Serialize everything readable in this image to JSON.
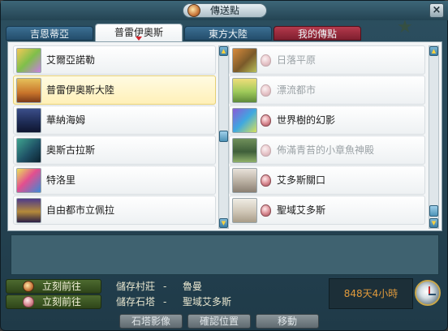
{
  "window": {
    "title": "傳送點"
  },
  "tabs": [
    {
      "label": "吉恩蒂亞",
      "active": false,
      "color": "#2e5e80"
    },
    {
      "label": "普雷伊奧斯",
      "active": true,
      "color": "#ffffff"
    },
    {
      "label": "東方大陸",
      "active": false,
      "color": "#2e5e80"
    },
    {
      "label": "我的傳點",
      "active": false,
      "color": "#9a2a3c"
    }
  ],
  "left_list": [
    {
      "label": "艾爾亞諾勒",
      "selected": false,
      "icon": "town-thumbnail"
    },
    {
      "label": "普雷伊奧斯大陸",
      "selected": true,
      "icon": "continent-thumbnail"
    },
    {
      "label": "華納海姆",
      "selected": false,
      "icon": "town-thumbnail"
    },
    {
      "label": "奧斯古拉斯",
      "selected": false,
      "icon": "town-thumbnail"
    },
    {
      "label": "特洛里",
      "selected": false,
      "icon": "town-thumbnail"
    },
    {
      "label": "自由都市立佩拉",
      "selected": false,
      "icon": "town-thumbnail"
    }
  ],
  "right_list": [
    {
      "label": "日落平原",
      "enabled": false
    },
    {
      "label": "漂流都市",
      "enabled": false
    },
    {
      "label": "世界樹的幻影",
      "enabled": true
    },
    {
      "label": "佈滿青苔的小章魚神殿",
      "enabled": false
    },
    {
      "label": "艾多斯關口",
      "enabled": true
    },
    {
      "label": "聖域艾多斯",
      "enabled": true
    }
  ],
  "bottom": {
    "go_button_1": "立刻前往",
    "go_button_2": "立刻前往",
    "saved_village_label": "儲存村莊",
    "saved_village_sep": "-",
    "saved_village_value": "魯曼",
    "saved_tower_label": "儲存石塔",
    "saved_tower_sep": "-",
    "saved_tower_value": "聖域艾多斯",
    "time_remaining": "848天4小時"
  },
  "actions": {
    "tower_image": "石塔影像",
    "confirm_location": "確認位置",
    "move": "移動"
  },
  "colors": {
    "frame": "#2c4f60",
    "selected_row": "#fff3c4",
    "time_text": "#e09a3c"
  }
}
